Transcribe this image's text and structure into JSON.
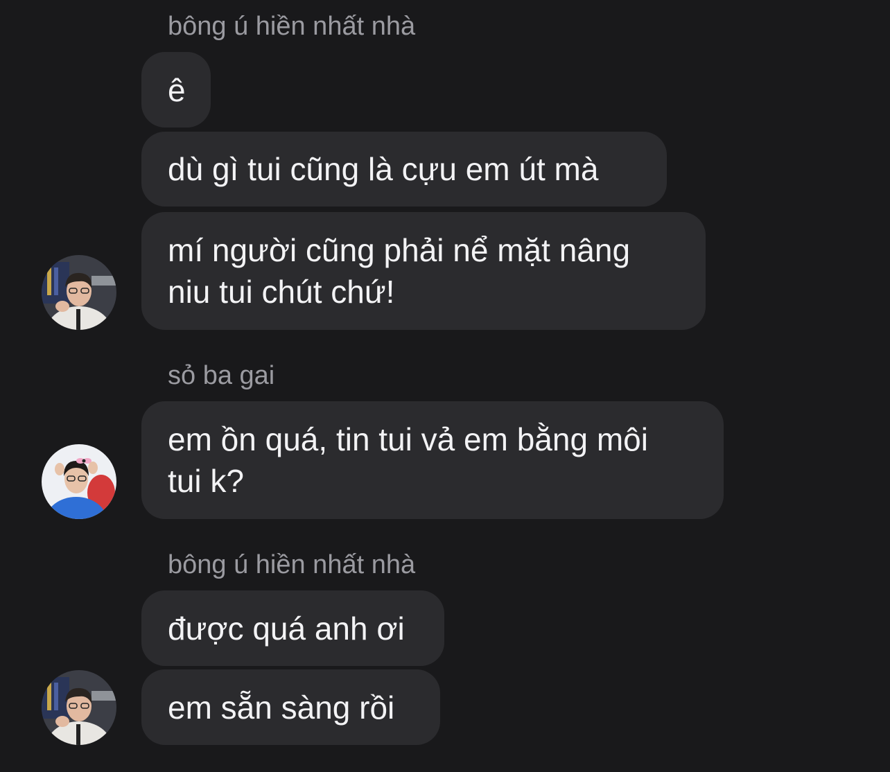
{
  "groups": [
    {
      "sender": "bông ú hiền nhất nhà",
      "messages": [
        {
          "lines": [
            "ê"
          ]
        },
        {
          "lines": [
            "dù gì tui cũng là cựu em út mà"
          ]
        },
        {
          "lines": [
            "mí người cũng phải nể mặt nâng",
            "niu tui chút chứ!"
          ]
        }
      ],
      "avatar_icon": "person-photo-avatar"
    },
    {
      "sender": "sỏ ba gai",
      "messages": [
        {
          "lines": [
            "em ồn quá, tin tui vả em bằng môi",
            "tui k?"
          ]
        }
      ],
      "avatar_icon": "person-photo-avatar"
    },
    {
      "sender": "bông ú hiền nhất nhà",
      "messages": [
        {
          "lines": [
            "được quá anh ơi"
          ]
        },
        {
          "lines": [
            "em sẵn sàng rồi"
          ]
        }
      ],
      "avatar_icon": "person-photo-avatar"
    }
  ],
  "colors": {
    "background": "#19191b",
    "bubble": "#2b2b2e",
    "sender_text": "#9b9ba1",
    "message_text": "#f3f3f5"
  }
}
